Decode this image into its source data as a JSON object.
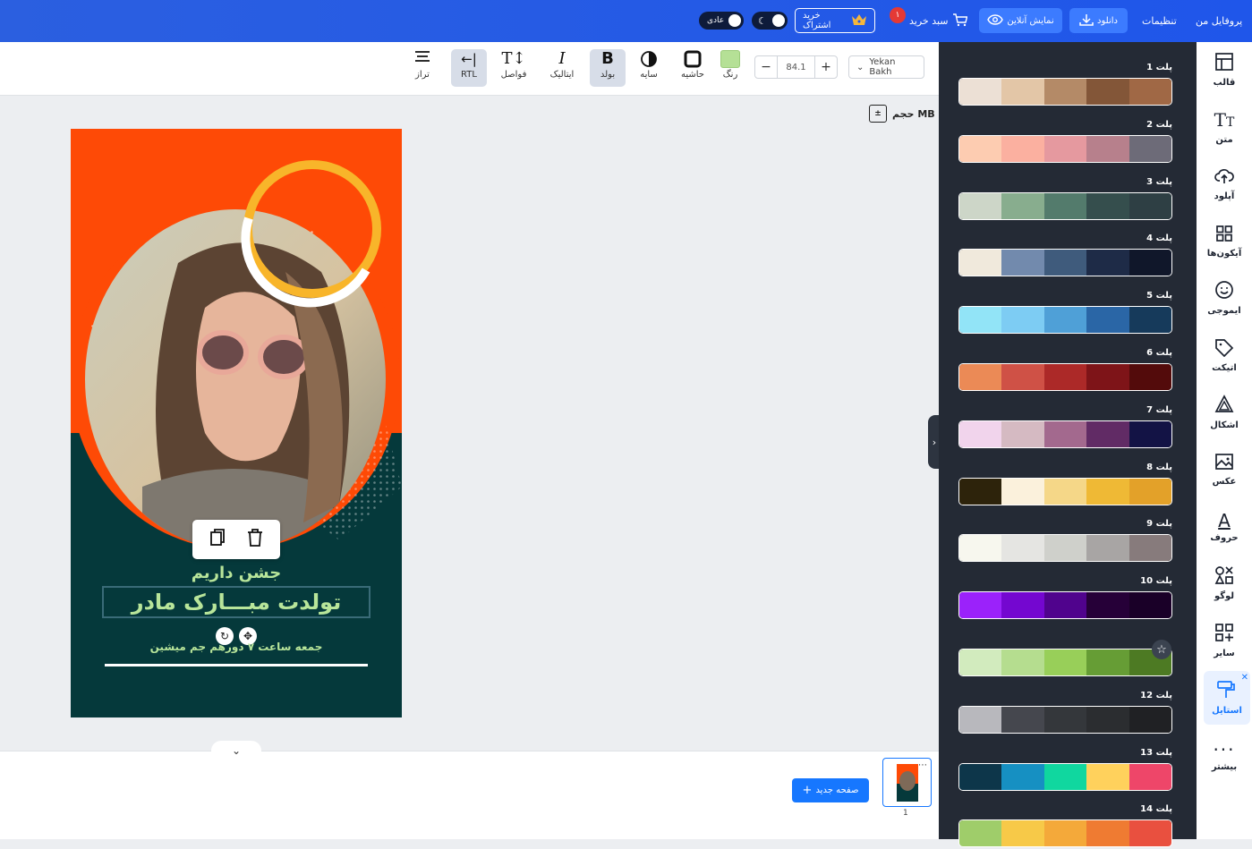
{
  "header": {
    "profile": "پروفایل من",
    "settings": "تنظیمات",
    "download": "دانلود",
    "online_preview": "نمایش آنلاین",
    "cart": "سبد خرید",
    "cart_count": "۱",
    "subscribe": "خرید اشتراک",
    "normal_mode": "عادی"
  },
  "toolbar": {
    "font_name": "Yekan Bakh",
    "font_size": "84.1",
    "color_label": "رنگ",
    "border_label": "حاشیه",
    "shadow_label": "سایه",
    "bold_label": "بولد",
    "italic_label": "ایتالیک",
    "spacing_label": "فواصل",
    "rtl_label": "RTL",
    "align_label": "تراز",
    "color_value": "#b5e096"
  },
  "canvas": {
    "size_label": "حجم MB",
    "text_top": "جشن داریم",
    "text_main": "تولدت مبـــارک مادر",
    "text_bottom": "جمعه ساعت ۷ دورهم جم میشین"
  },
  "pages": {
    "new_page": "صفحه جدید",
    "page_number": "1"
  },
  "palettes": [
    {
      "title": "پلت 1",
      "colors": [
        "#ece0d5",
        "#e3c6a7",
        "#b48a67",
        "#835638",
        "#a06845"
      ]
    },
    {
      "title": "پلت 2",
      "colors": [
        "#fdccb1",
        "#fbb0a0",
        "#e5999f",
        "#b7808c",
        "#6d6b78"
      ]
    },
    {
      "title": "پلت 3",
      "colors": [
        "#cdd6c8",
        "#88ad8e",
        "#537b6c",
        "#354e4d",
        "#2e3f44"
      ]
    },
    {
      "title": "پلت 4",
      "colors": [
        "#f0e9dc",
        "#728aad",
        "#3f5b7c",
        "#1e2b47",
        "#10172a"
      ]
    },
    {
      "title": "پلت 5",
      "colors": [
        "#92e4f7",
        "#7dccf3",
        "#4fa0d7",
        "#2a66a6",
        "#163a5b"
      ]
    },
    {
      "title": "پلت 6",
      "colors": [
        "#eb8a56",
        "#cf5146",
        "#ac2928",
        "#7e1418",
        "#530b0b"
      ]
    },
    {
      "title": "پلت 7",
      "colors": [
        "#f1d4ec",
        "#d5bac2",
        "#a3698e",
        "#612b65",
        "#131345"
      ]
    },
    {
      "title": "پلت 8",
      "colors": [
        "#2d230b",
        "#fbf1dc",
        "#f5d788",
        "#efb935",
        "#e3a129"
      ]
    },
    {
      "title": "پلت 9",
      "colors": [
        "#f7f7ee",
        "#e5e5e2",
        "#cfd0cb",
        "#a8a5a4",
        "#877b7c"
      ]
    },
    {
      "title": "پلت 10",
      "colors": [
        "#9b22fa",
        "#7407d0",
        "#50038d",
        "#260038",
        "#1a0028"
      ]
    },
    {
      "title": "",
      "colors": [
        "#d2ebbe",
        "#b5dd8f",
        "#98cf59",
        "#669d35",
        "#4d7a23"
      ]
    },
    {
      "title": "پلت 12",
      "colors": [
        "#b8b8bd",
        "#45474e",
        "#34373b",
        "#2b2d30",
        "#202124"
      ]
    },
    {
      "title": "پلت 13",
      "colors": [
        "#0d364a",
        "#1690c2",
        "#10d79f",
        "#ffd15c",
        "#ee4669"
      ]
    },
    {
      "title": "پلت 14",
      "colors": [
        "#9fcd6a",
        "#f7c948",
        "#f4a93a",
        "#ef7b32",
        "#e9503f"
      ]
    }
  ],
  "sidebar": {
    "items": [
      {
        "label": "قالب",
        "icon": "layout-icon"
      },
      {
        "label": "متن",
        "icon": "text-icon"
      },
      {
        "label": "آپلود",
        "icon": "upload-icon"
      },
      {
        "label": "آیکون‌ها",
        "icon": "grid-icon"
      },
      {
        "label": "ایموجی",
        "icon": "emoji-icon"
      },
      {
        "label": "اتیکت",
        "icon": "tag-icon"
      },
      {
        "label": "اشکال",
        "icon": "shapes-icon"
      },
      {
        "label": "عکس",
        "icon": "image-icon"
      },
      {
        "label": "حروف",
        "icon": "letter-icon"
      },
      {
        "label": "لوگو",
        "icon": "logo-icon"
      },
      {
        "label": "سایر",
        "icon": "more-grid-icon"
      },
      {
        "label": "استایل",
        "icon": "style-icon"
      },
      {
        "label": "بیشتر",
        "icon": "dots-icon"
      }
    ]
  }
}
